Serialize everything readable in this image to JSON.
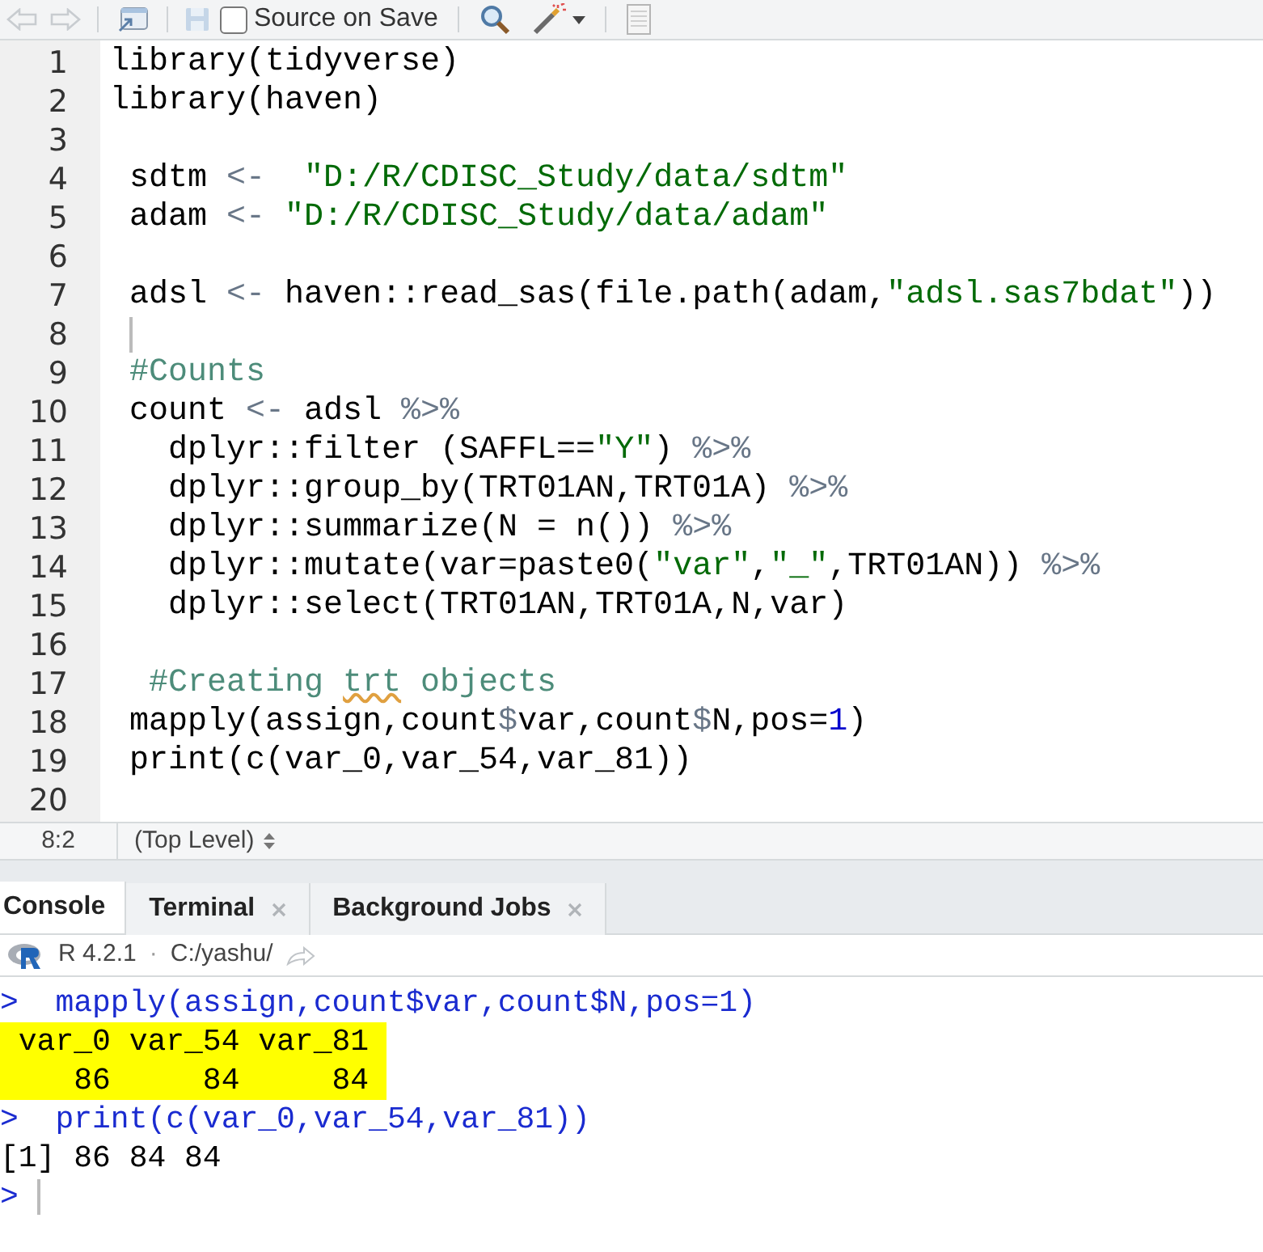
{
  "toolbar": {
    "source_on_save": {
      "label": "Source on Save",
      "checked": false
    }
  },
  "editor": {
    "lines": [
      {
        "number": "1",
        "tokens": [
          {
            "kind": "code",
            "text": "library(tidyverse)"
          }
        ]
      },
      {
        "number": "2",
        "tokens": [
          {
            "kind": "code",
            "text": "library(haven)"
          }
        ]
      },
      {
        "number": "3"
      },
      {
        "number": "4",
        "tokens": [
          {
            "kind": "code",
            "text": " sdtm "
          },
          {
            "kind": "operator",
            "text": "<-  "
          },
          {
            "kind": "string",
            "text": "\"D:/R/CDISC_Study/data/sdtm\""
          }
        ]
      },
      {
        "number": "5",
        "tokens": [
          {
            "kind": "code",
            "text": " adam "
          },
          {
            "kind": "operator",
            "text": "<- "
          },
          {
            "kind": "string",
            "text": "\"D:/R/CDISC_Study/data/adam\""
          }
        ]
      },
      {
        "number": "6"
      },
      {
        "number": "7",
        "tokens": [
          {
            "kind": "code",
            "text": " adsl "
          },
          {
            "kind": "operator",
            "text": "<-"
          },
          {
            "kind": "code",
            "text": " haven::read_sas(file.path(adam,"
          },
          {
            "kind": "string",
            "text": "\"adsl.sas7bdat\""
          },
          {
            "kind": "code",
            "text": "))"
          }
        ]
      },
      {
        "number": "8",
        "cursor": true
      },
      {
        "number": "9",
        "tokens": [
          {
            "kind": "comment",
            "text": " #Counts"
          }
        ]
      },
      {
        "number": "10",
        "tokens": [
          {
            "kind": "code",
            "text": " count "
          },
          {
            "kind": "operator",
            "text": "<-"
          },
          {
            "kind": "code",
            "text": " adsl "
          },
          {
            "kind": "operator",
            "text": "%>%"
          }
        ]
      },
      {
        "number": "11",
        "tokens": [
          {
            "kind": "code",
            "text": "   dplyr::filter (SAFFL=="
          },
          {
            "kind": "string",
            "text": "\"Y\""
          },
          {
            "kind": "code",
            "text": ") "
          },
          {
            "kind": "operator",
            "text": "%>%"
          }
        ]
      },
      {
        "number": "12",
        "tokens": [
          {
            "kind": "code",
            "text": "   dplyr::group_by(TRT01AN,TRT01A) "
          },
          {
            "kind": "operator",
            "text": "%>%"
          }
        ]
      },
      {
        "number": "13",
        "tokens": [
          {
            "kind": "code",
            "text": "   dplyr::summarize(N = n()) "
          },
          {
            "kind": "operator",
            "text": "%>%"
          }
        ]
      },
      {
        "number": "14",
        "tokens": [
          {
            "kind": "code",
            "text": "   dplyr::mutate(var=paste0("
          },
          {
            "kind": "string",
            "text": "\"var\""
          },
          {
            "kind": "code",
            "text": ","
          },
          {
            "kind": "string",
            "text": "\"_\""
          },
          {
            "kind": "code",
            "text": ",TRT01AN)) "
          },
          {
            "kind": "operator",
            "text": "%>%"
          }
        ]
      },
      {
        "number": "15",
        "tokens": [
          {
            "kind": "code",
            "text": "   dplyr::select(TRT01AN,TRT01A,N,var)"
          }
        ]
      },
      {
        "number": "16"
      },
      {
        "number": "17",
        "tokens": [
          {
            "kind": "comment",
            "text": "  #Creating "
          },
          {
            "kind": "comment",
            "text": "trt",
            "misspelled": true
          },
          {
            "kind": "comment",
            "text": " objects"
          }
        ]
      },
      {
        "number": "18",
        "tokens": [
          {
            "kind": "code",
            "text": " mapply(assign,count"
          },
          {
            "kind": "operator",
            "text": "$"
          },
          {
            "kind": "code",
            "text": "var,count"
          },
          {
            "kind": "operator",
            "text": "$"
          },
          {
            "kind": "code",
            "text": "N,pos="
          },
          {
            "kind": "number",
            "text": "1"
          },
          {
            "kind": "code",
            "text": ")"
          }
        ]
      },
      {
        "number": "19",
        "tokens": [
          {
            "kind": "code",
            "text": " print(c(var_0,var_54,var_81))"
          }
        ]
      },
      {
        "number": "20"
      }
    ]
  },
  "status_bar": {
    "position": "8:2",
    "scope": "(Top Level)"
  },
  "console_tabs": [
    {
      "label": "Console",
      "selected": true,
      "closable": false
    },
    {
      "label": "Terminal",
      "selected": false,
      "closable": true
    },
    {
      "label": "Background Jobs",
      "selected": false,
      "closable": true
    }
  ],
  "console": {
    "version": "R 4.2.1",
    "separator": "·",
    "path": "C:/yashu/",
    "lines": [
      {
        "kind": "input",
        "prompt": ">",
        "text": "  mapply(assign,count$var,count$N,pos=1)"
      },
      {
        "kind": "output",
        "text": " var_0 var_54 var_81 ",
        "highlighted": true
      },
      {
        "kind": "output",
        "text": "    86     84     84 ",
        "highlighted": true
      },
      {
        "kind": "input",
        "prompt": ">",
        "text": "  print(c(var_0,var_54,var_81))"
      },
      {
        "kind": "output",
        "text": "[1] 86 84 84",
        "highlighted": false
      },
      {
        "kind": "input",
        "prompt": ">",
        "cursor": true
      }
    ]
  }
}
